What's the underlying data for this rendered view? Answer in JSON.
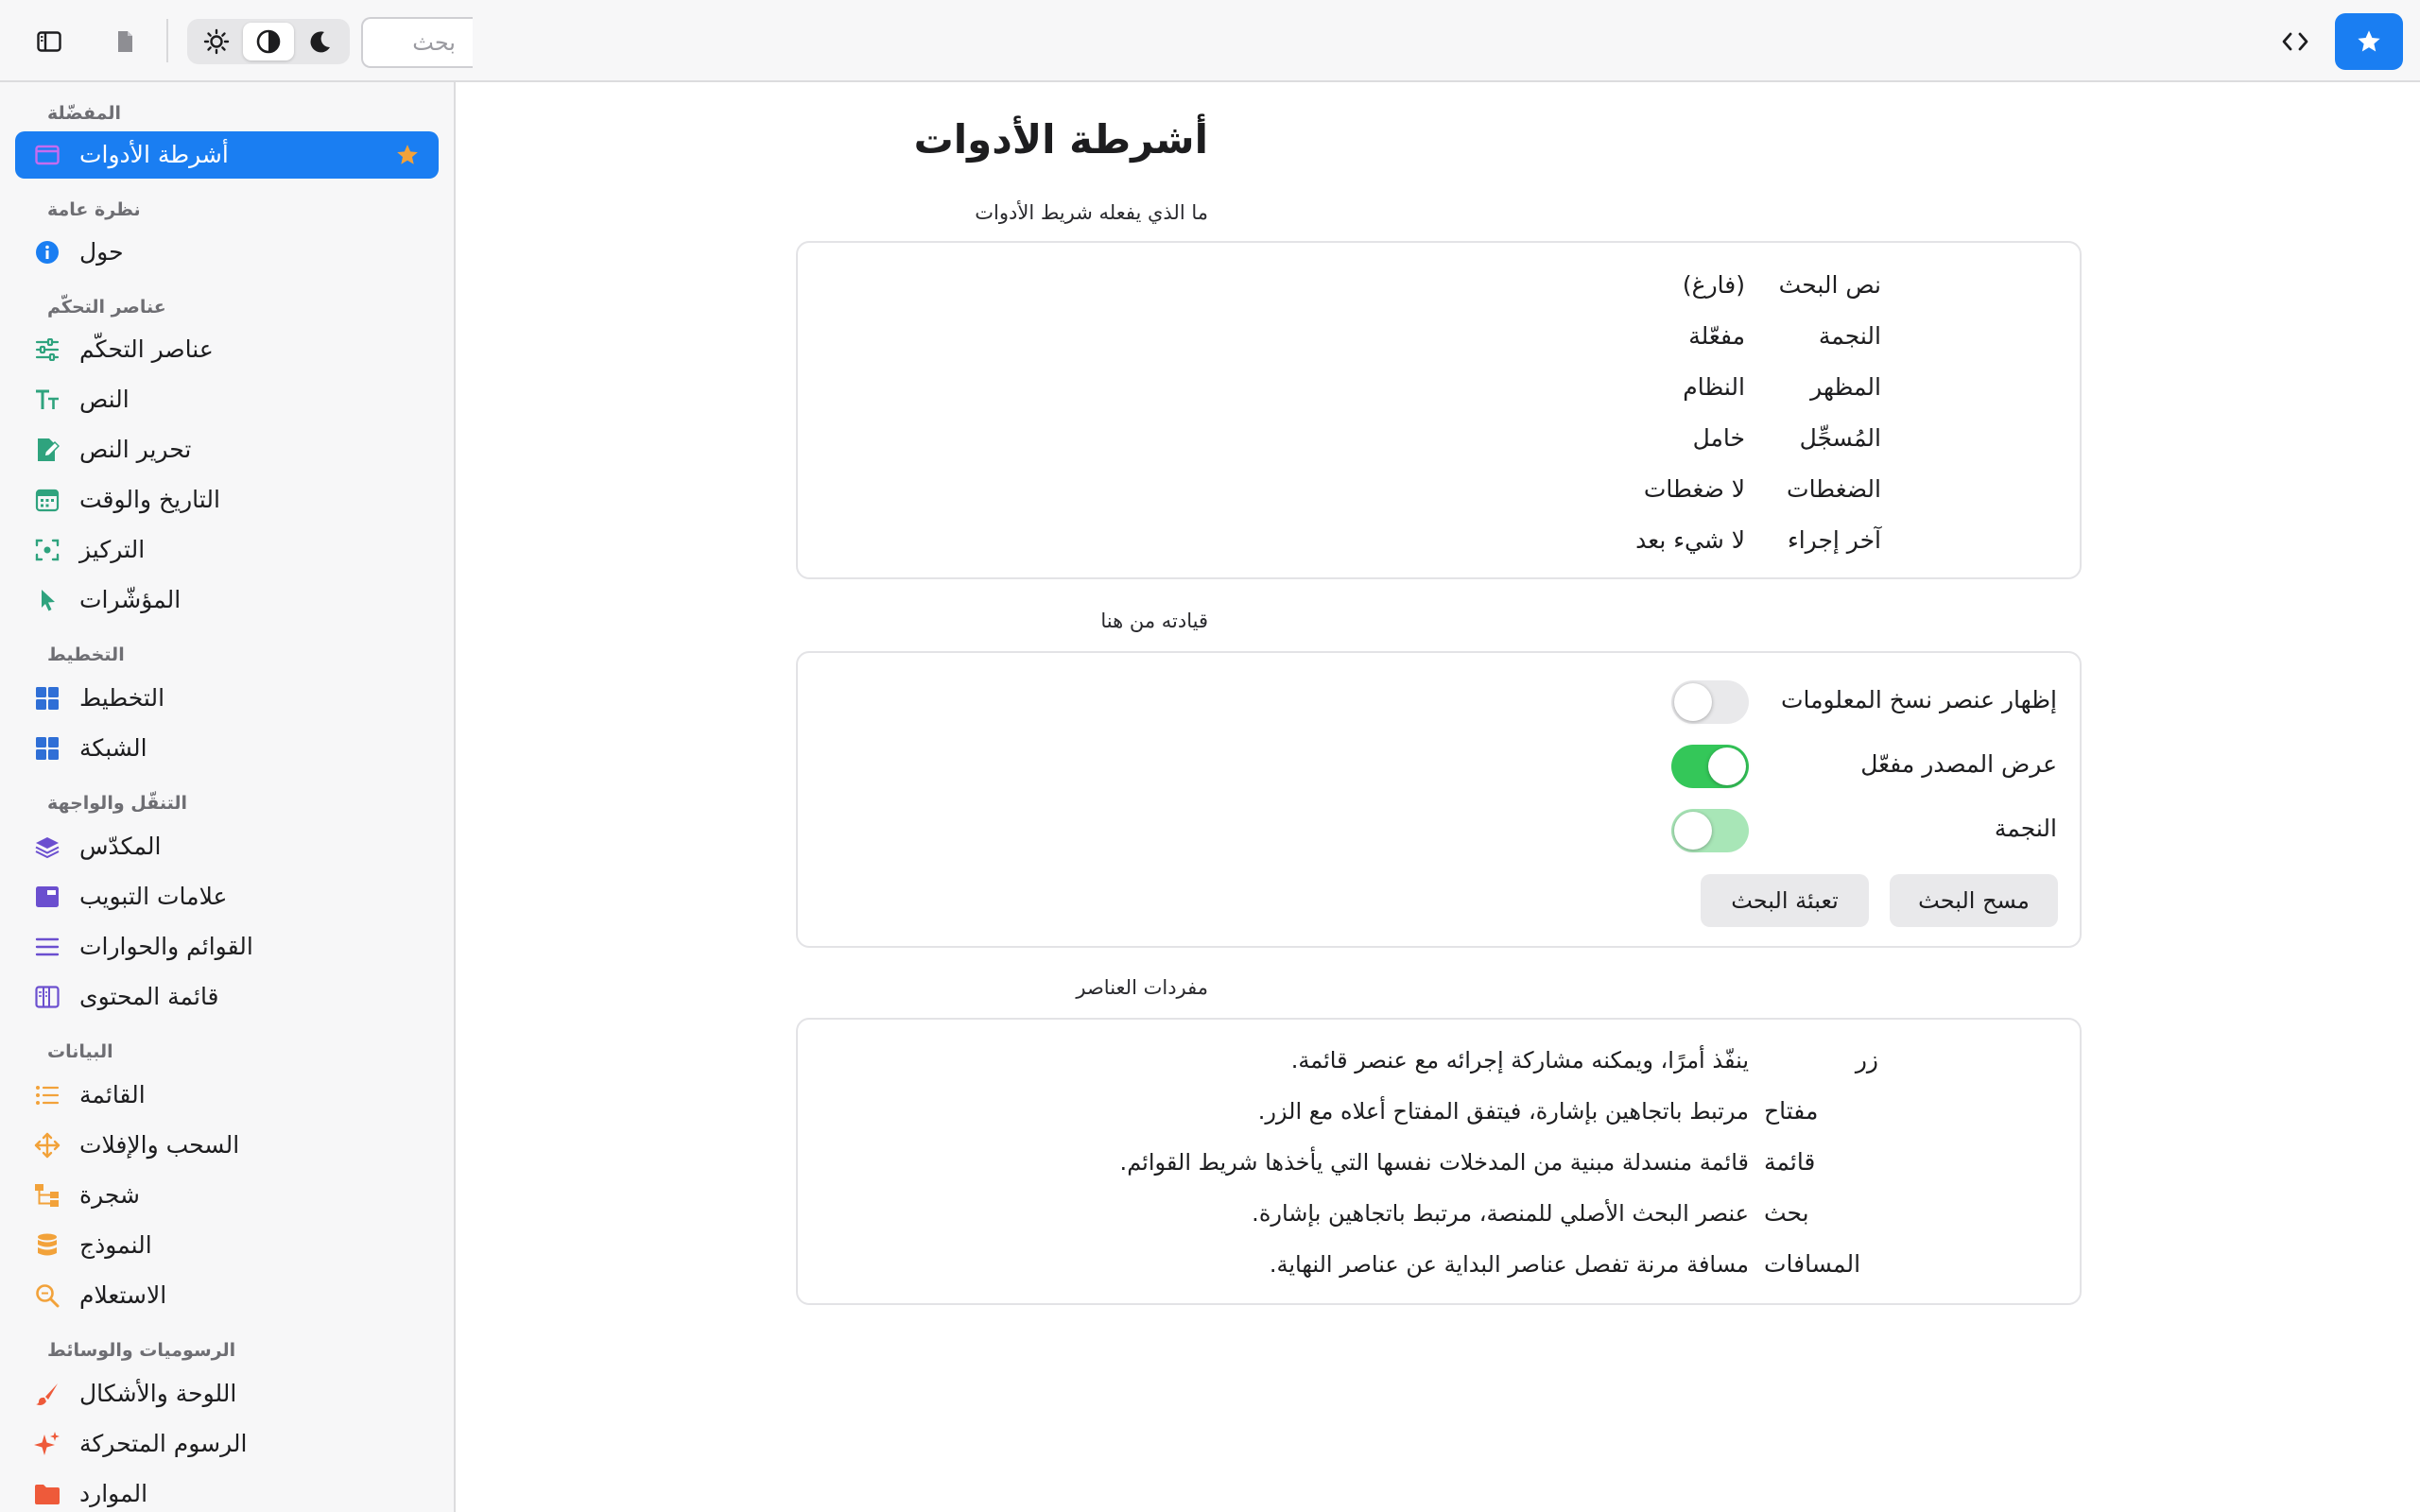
{
  "toolbar": {
    "search_placeholder": "بحث"
  },
  "colors": {
    "accent": "#1a7ef2",
    "toggle_on": "#34c759",
    "star": "#f2a23a"
  },
  "sidebar": {
    "sections": {
      "favorites": "المفضّلة",
      "overview": "نظرة عامة",
      "controls": "عناصر التحكّم",
      "layout": "التخطيط",
      "navigation": "التنقّل والواجهة",
      "data": "البيانات",
      "graphics": "الرسوميات والوسائط"
    },
    "items": {
      "toolbars": "أشرطة الأدوات",
      "about": "حول",
      "controls": "عناصر التحكّم",
      "text": "النص",
      "text_editing": "تحرير النص",
      "date_time": "التاريخ والوقت",
      "focus": "التركيز",
      "pointers": "المؤشّرات",
      "layout": "التخطيط",
      "grid": "الشبكة",
      "stack": "المكدّس",
      "tabs": "علامات التبويب",
      "menus_dialogs": "القوائم والحوارات",
      "content_list": "قائمة المحتوى",
      "list": "القائمة",
      "drag_drop": "السحب والإفلات",
      "tree": "شجرة",
      "model": "النموذج",
      "query": "الاستعلام",
      "canvas_shapes": "اللوحة والأشكال",
      "animations": "الرسوم المتحركة",
      "resources": "الموارد"
    }
  },
  "main": {
    "title": "أشرطة الأدوات",
    "what_label": "ما الذي يفعله شريط الأدوات",
    "status": [
      {
        "key": "نص البحث",
        "value": "(فارغ)"
      },
      {
        "key": "النجمة",
        "value": "مفعّلة"
      },
      {
        "key": "المظهر",
        "value": "النظام"
      },
      {
        "key": "المُسجِّل",
        "value": "خامل"
      },
      {
        "key": "الضغطات",
        "value": "لا ضغطات"
      },
      {
        "key": "آخر إجراء",
        "value": "لا شيء بعد"
      }
    ],
    "drive_label": "قيادته من هنا",
    "toggles": [
      {
        "label": "إظهار عنصر نسخ المعلومات",
        "on": false
      },
      {
        "label": "عرض المصدر مفعّل",
        "on": true
      },
      {
        "label": "النجمة",
        "on": true
      }
    ],
    "buttons": {
      "clear_search": "مسح البحث",
      "fill_search": "تعبئة البحث"
    },
    "vocab_label": "مفردات العناصر",
    "vocab": [
      {
        "term": "زر",
        "desc": ".ينفّذ أمرًا، ويمكنه مشاركة إجرائه مع عنصر قائمة"
      },
      {
        "term": "مفتاح",
        "desc": ".مرتبط باتجاهين بإشارة، فيتفق المفتاح أعلاه مع الزر"
      },
      {
        "term": "قائمة",
        "desc": ".قائمة منسدلة مبنية من المدخلات نفسها التي يأخذها شريط القوائم"
      },
      {
        "term": "بحث",
        "desc": ".عنصر البحث الأصلي للمنصة، مرتبط باتجاهين بإشارة"
      },
      {
        "term": "المسافات",
        "desc": ".مسافة مرنة تفصل عناصر البداية عن عناصر النهاية"
      }
    ]
  }
}
